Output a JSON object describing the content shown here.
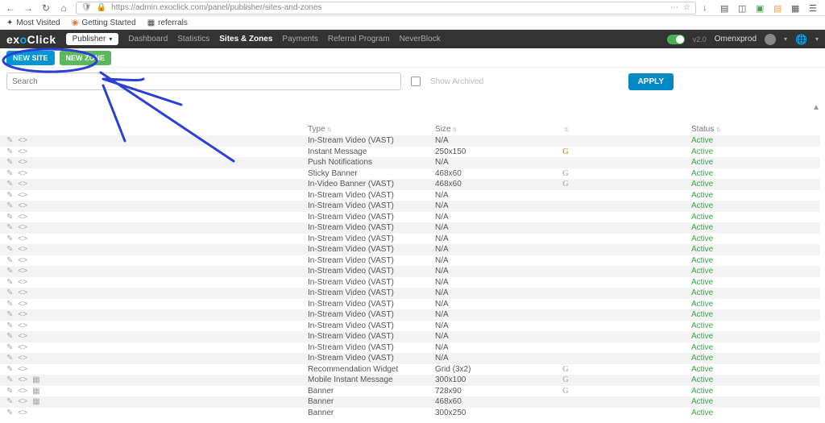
{
  "browser": {
    "url": "https://admin.exoclick.com/panel/publisher/sites-and-zones",
    "bookmarks": [
      "Most Visited",
      "Getting Started",
      "referrals"
    ]
  },
  "appbar": {
    "logo_pre": "ex",
    "logo_o": "o",
    "logo_post": "Click",
    "role_label": "Publisher",
    "nav": [
      "Dashboard",
      "Statistics",
      "Sites & Zones",
      "Payments",
      "Referral Program",
      "NeverBlock"
    ],
    "active_nav": "Sites & Zones",
    "version": "v2.0",
    "username": "Omenxprod"
  },
  "actions": {
    "new_site": "NEW SITE",
    "new_zone": "NEW ZONE"
  },
  "search": {
    "placeholder": "Search",
    "archived_label": "Show Archived",
    "apply": "APPLY"
  },
  "table": {
    "headers": {
      "type": "Type",
      "size": "Size",
      "status": "Status"
    },
    "rows": [
      {
        "type": "In-Stream Video (VAST)",
        "size": "N/A",
        "g": "",
        "status": "Active"
      },
      {
        "type": "Instant Message",
        "size": "250x150",
        "g": "color",
        "status": "Active"
      },
      {
        "type": "Push Notifications",
        "size": "N/A",
        "g": "",
        "status": "Active"
      },
      {
        "type": "Sticky Banner",
        "size": "468x60",
        "g": "gray",
        "status": "Active"
      },
      {
        "type": "In-Video Banner (VAST)",
        "size": "468x60",
        "g": "gray",
        "status": "Active"
      },
      {
        "type": "In-Stream Video (VAST)",
        "size": "N/A",
        "g": "",
        "status": "Active"
      },
      {
        "type": "In-Stream Video (VAST)",
        "size": "N/A",
        "g": "",
        "status": "Active"
      },
      {
        "type": "In-Stream Video (VAST)",
        "size": "N/A",
        "g": "",
        "status": "Active"
      },
      {
        "type": "In-Stream Video (VAST)",
        "size": "N/A",
        "g": "",
        "status": "Active"
      },
      {
        "type": "In-Stream Video (VAST)",
        "size": "N/A",
        "g": "",
        "status": "Active"
      },
      {
        "type": "In-Stream Video (VAST)",
        "size": "N/A",
        "g": "",
        "status": "Active"
      },
      {
        "type": "In-Stream Video (VAST)",
        "size": "N/A",
        "g": "",
        "status": "Active"
      },
      {
        "type": "In-Stream Video (VAST)",
        "size": "N/A",
        "g": "",
        "status": "Active"
      },
      {
        "type": "In-Stream Video (VAST)",
        "size": "N/A",
        "g": "",
        "status": "Active"
      },
      {
        "type": "In-Stream Video (VAST)",
        "size": "N/A",
        "g": "",
        "status": "Active"
      },
      {
        "type": "In-Stream Video (VAST)",
        "size": "N/A",
        "g": "",
        "status": "Active"
      },
      {
        "type": "In-Stream Video (VAST)",
        "size": "N/A",
        "g": "",
        "status": "Active"
      },
      {
        "type": "In-Stream Video (VAST)",
        "size": "N/A",
        "g": "",
        "status": "Active"
      },
      {
        "type": "In-Stream Video (VAST)",
        "size": "N/A",
        "g": "",
        "status": "Active"
      },
      {
        "type": "In-Stream Video (VAST)",
        "size": "N/A",
        "g": "",
        "status": "Active"
      },
      {
        "type": "In-Stream Video (VAST)",
        "size": "N/A",
        "g": "",
        "status": "Active"
      },
      {
        "type": "Recommendation Widget",
        "size": "Grid (3x2)",
        "g": "gray",
        "status": "Active"
      },
      {
        "type": "Mobile Instant Message",
        "size": "300x100",
        "g": "gray",
        "status": "Active"
      },
      {
        "type": "Banner",
        "size": "728x90",
        "g": "gray",
        "status": "Active"
      },
      {
        "type": "Banner",
        "size": "468x60",
        "g": "",
        "status": "Active"
      },
      {
        "type": "Banner",
        "size": "300x250",
        "g": "",
        "status": "Active"
      }
    ]
  }
}
